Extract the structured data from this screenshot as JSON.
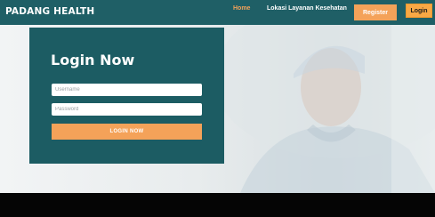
{
  "navbar": {
    "brand": "PADANG HEALTH",
    "links": [
      {
        "label": "Home"
      },
      {
        "label": "Lokasi Layanan Kesehatan"
      }
    ],
    "register_label": "Register",
    "login_label": "Login"
  },
  "login": {
    "title": "Login Now",
    "username_placeholder": "Username",
    "password_placeholder": "Password",
    "submit_label": "LOGIN NOW"
  },
  "colors": {
    "navbar": "#1f5f66",
    "accent": "#f4a259",
    "card": "#1c5c63",
    "footer": "#050505"
  },
  "icons": {
    "hero_image": "doctor-photo"
  }
}
